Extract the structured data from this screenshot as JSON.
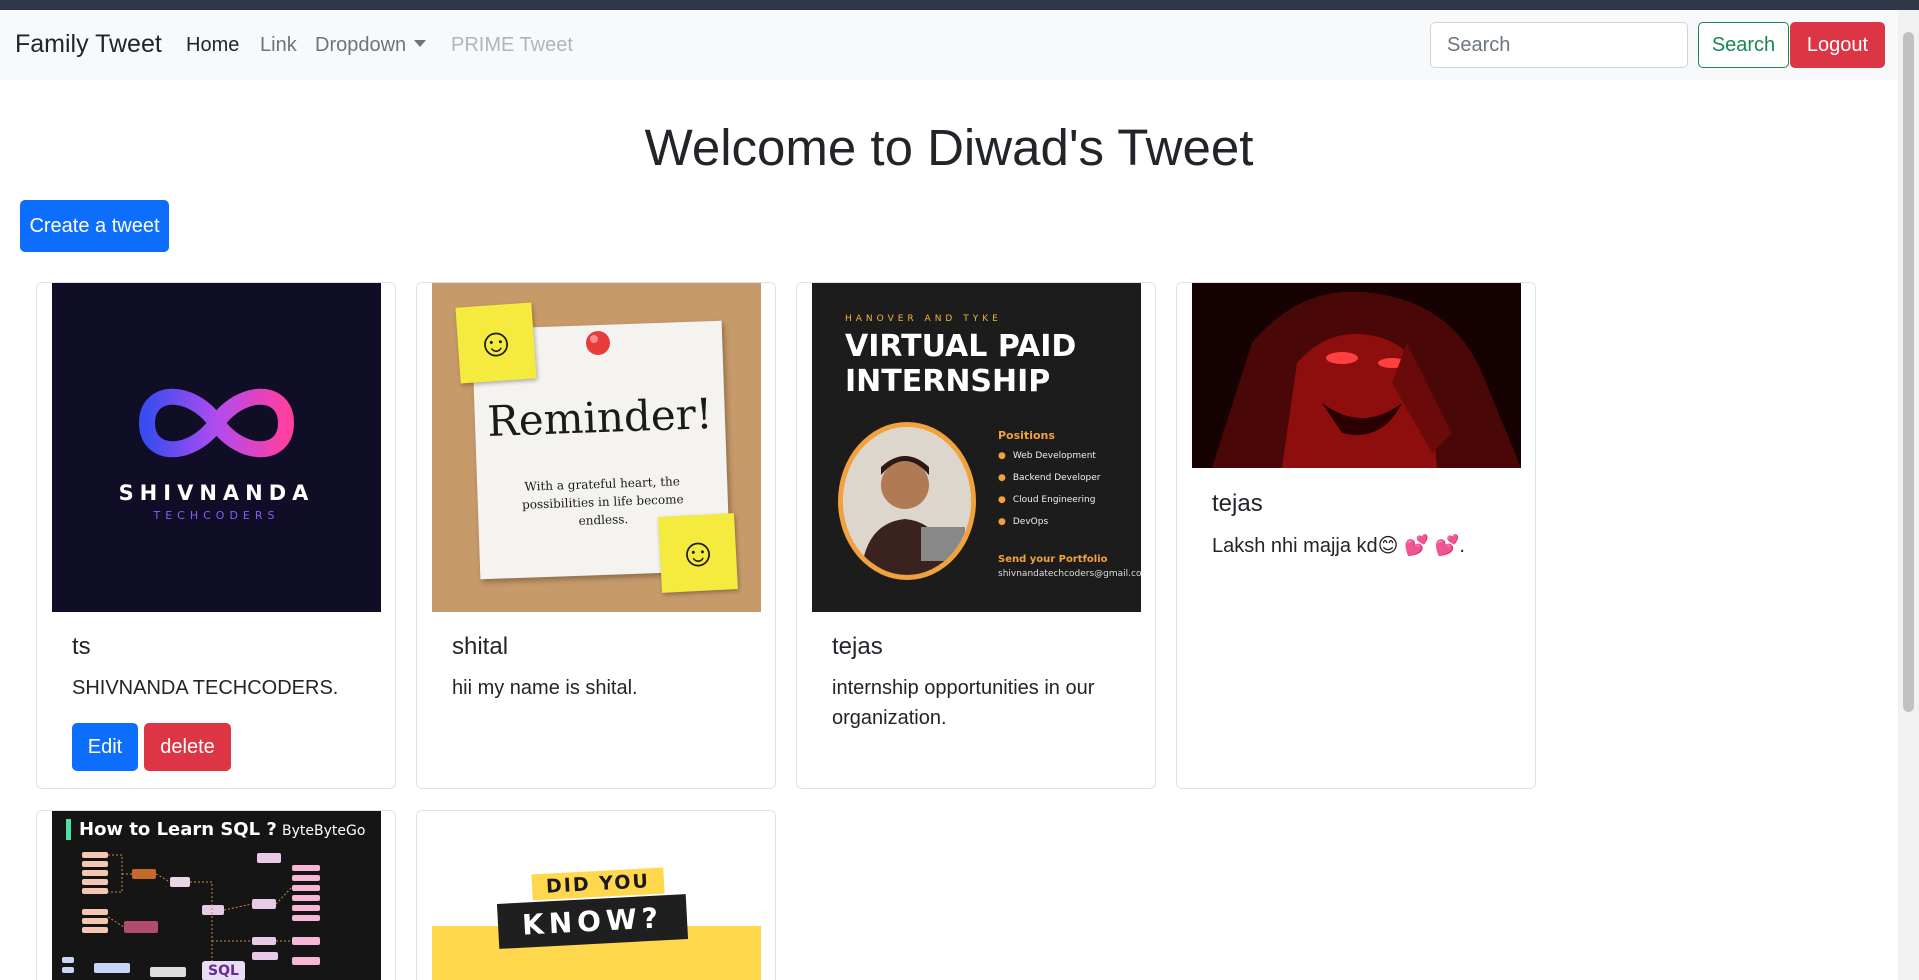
{
  "navbar": {
    "brand": "Family Tweet",
    "links": [
      "Home",
      "Link",
      "Dropdown",
      "PRIME Tweet"
    ],
    "search_placeholder": "Search",
    "search_button": "Search",
    "logout_button": "Logout"
  },
  "page_title": "Welcome to Diwad's Tweet",
  "create_button": "Create a tweet",
  "tweets": [
    {
      "author": "ts",
      "text": "SHIVNANDA TECHCODERS.",
      "edit_label": "Edit",
      "delete_label": "delete",
      "image": {
        "word": "SHIVNANDA",
        "sub": "TECHCODERS"
      }
    },
    {
      "author": "shital",
      "text": "hii my name is shital.",
      "image": {
        "title": "Reminder!",
        "body": "With a grateful heart, the possibilities in life become endless."
      }
    },
    {
      "author": "tejas",
      "text": "internship opportunities in our organization.",
      "image": {
        "top": "HANOVER AND TYKE",
        "headline": "VIRTUAL PAID INTERNSHIP",
        "positions_label": "Positions",
        "positions": [
          "Web Development",
          "Backend Developer",
          "Cloud Engineering",
          "DevOps"
        ],
        "send_label": "Send your Portfolio",
        "email": "shivnandatechcoders@gmail.com"
      }
    },
    {
      "author": "tejas",
      "text": "Laksh nhi majja kd😊 💕 💕."
    },
    {
      "image": {
        "title": "How to Learn SQL ?",
        "brand": "ByteByteGo",
        "core": "SQL"
      }
    },
    {
      "image": {
        "line1": "DID YOU",
        "line2": "KNOW?"
      }
    }
  ],
  "colors": {
    "primary": "#0d6efd",
    "danger": "#dc3545",
    "success": "#198754",
    "navbar_bg": "#f8f9fa"
  }
}
